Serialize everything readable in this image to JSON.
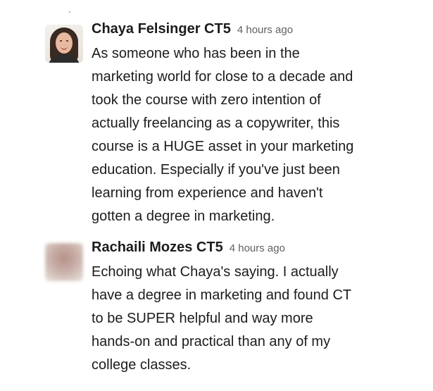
{
  "messages": [
    {
      "author": "Chaya Felsinger CT5",
      "timestamp": "4 hours ago",
      "avatar": "photo-avatar",
      "lines": [
        "As someone who has been in the",
        "marketing world for close to a decade and",
        "took the course with zero intention of",
        "actually freelancing as a copywriter, this",
        "course is a HUGE asset in your marketing",
        "education. Especially if you've just been",
        "learning from experience and haven't",
        "gotten a degree in marketing."
      ]
    },
    {
      "author": "Rachaili Mozes CT5",
      "timestamp": "4 hours ago",
      "avatar": "blurred-avatar",
      "lines": [
        "Echoing what Chaya's saying. I actually",
        "have a degree in marketing and found CT",
        "to be SUPER helpful and way more",
        "hands-on and practical than any of my",
        "college classes."
      ]
    }
  ]
}
